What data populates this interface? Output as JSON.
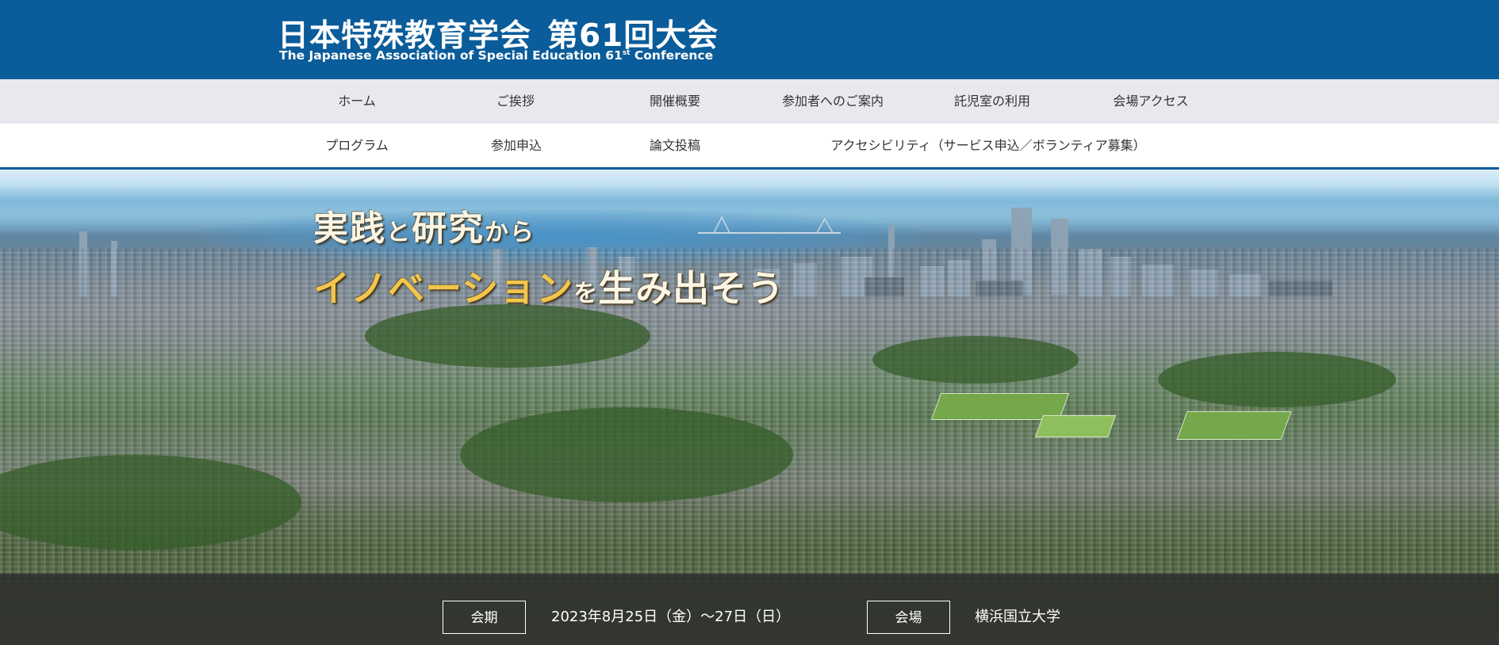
{
  "header": {
    "title_main": "日本特殊教育学会",
    "title_conf": "第61回大会",
    "subtitle_pre": "The Japanese Association of Special Education 61",
    "subtitle_sup": "st",
    "subtitle_post": " Conference",
    "bg_color": "#0a5c9a"
  },
  "nav": {
    "row1": [
      "ホーム",
      "ご挨拶",
      "開催概要",
      "参加者へのご案内",
      "託児室の利用",
      "会場アクセス"
    ],
    "row2": [
      "プログラム",
      "参加申込",
      "論文投稿",
      "アクセシビリティ（サービス申込／ボランティア募集）"
    ]
  },
  "hero": {
    "tagline_line1_a": "実践",
    "tagline_line1_b": "と",
    "tagline_line1_c": "研究",
    "tagline_line1_d": "から",
    "tagline_line2_a": "イノベーション",
    "tagline_line2_b": "を",
    "tagline_line2_c": "生み出そう",
    "accent_color": "#f2c64a"
  },
  "info": {
    "period_label": "会期",
    "period_value": "2023年8月25日（金）～27日（日）",
    "venue_label": "会場",
    "venue_value": "横浜国立大学"
  }
}
